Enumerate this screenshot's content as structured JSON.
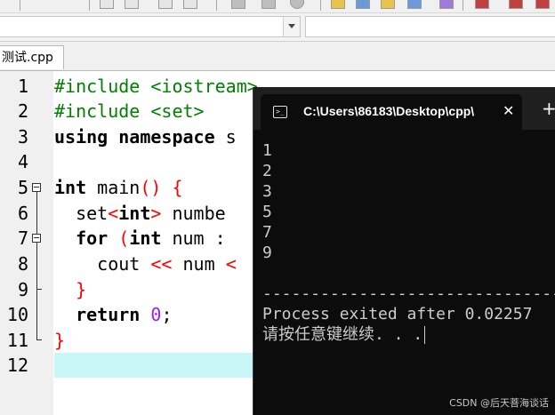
{
  "toolbar": {
    "buttons": [
      "new-file-icon",
      "open-file-icon",
      "save-icon",
      "compile-icon",
      "run-icon",
      "debug-icon",
      "class-browser-icon",
      "toggle-breakpoint-icon"
    ]
  },
  "file_tab": {
    "label": "测试.cpp"
  },
  "editor": {
    "line_numbers": [
      "1",
      "2",
      "3",
      "4",
      "5",
      "6",
      "7",
      "8",
      "9",
      "10",
      "11",
      "12"
    ]
  },
  "terminal": {
    "title": "C:\\Users\\86183\\Desktop\\cpp\\",
    "close_glyph": "✕",
    "new_tab_glyph": "+",
    "output_lines": [
      "1",
      "2",
      "3",
      "5",
      "7",
      "9"
    ],
    "separator": "--------------------------------",
    "process_exit": "Process exited after 0.02257",
    "press_key": "请按任意键继续. . ."
  },
  "watermark": "CSDN @后天菩海谈话"
}
